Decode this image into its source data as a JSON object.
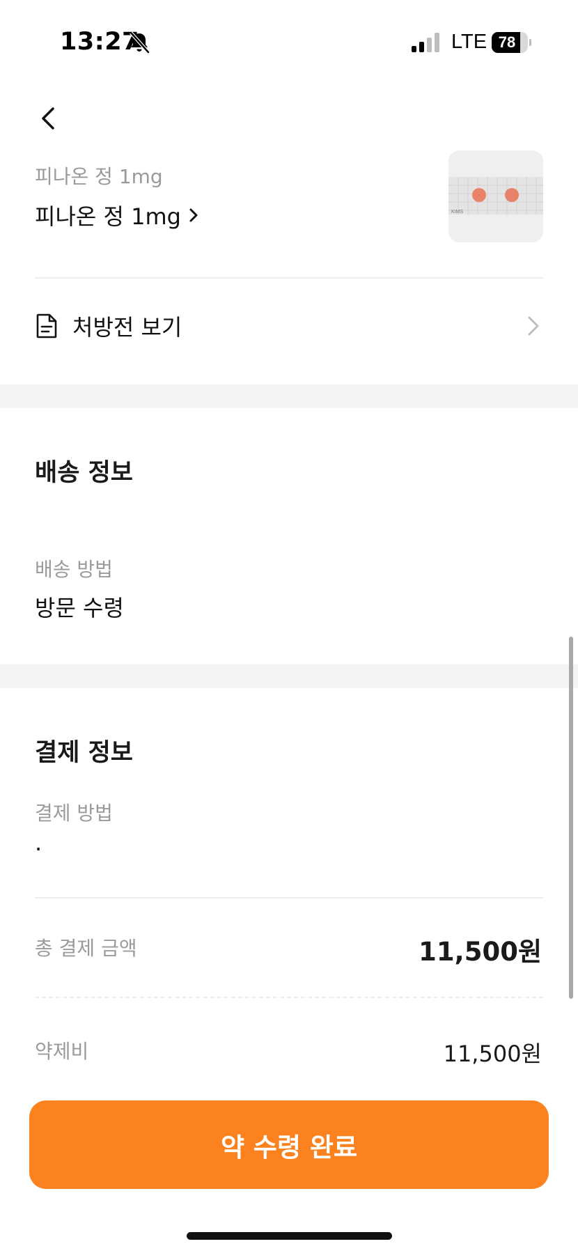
{
  "status_bar": {
    "time": "13:27",
    "network": "LTE",
    "battery_percent": "78",
    "battery_level": 0.78,
    "icons": [
      "bell-slash-icon",
      "cellular-signal-icon",
      "battery-icon"
    ]
  },
  "header": {
    "back_icon": "chevron-left-icon"
  },
  "drug": {
    "caption": "피나온 정 1mg",
    "name": "피나온 정 1mg",
    "link_icon": "chevron-right-icon",
    "thumbnail_icon": "pill-photo",
    "thumbnail_text": "KIMS"
  },
  "prescription": {
    "label": "처방전 보기",
    "icon": "document-icon"
  },
  "delivery": {
    "title": "배송 정보",
    "method_label": "배송 방법",
    "method_value": "방문 수령"
  },
  "payment": {
    "title": "결제 정보",
    "method_label": "결제 방법",
    "method_value": "·",
    "total_label": "총 결제 금액",
    "total_amount": "11,500원",
    "drug_fee_label": "약제비",
    "drug_fee_amount": "11,500원"
  },
  "cta": {
    "label": "약 수령 완료"
  },
  "colors": {
    "accent": "#fb821e",
    "section_gap": "#f3f4f6",
    "muted_text": "#9a9a9a"
  }
}
